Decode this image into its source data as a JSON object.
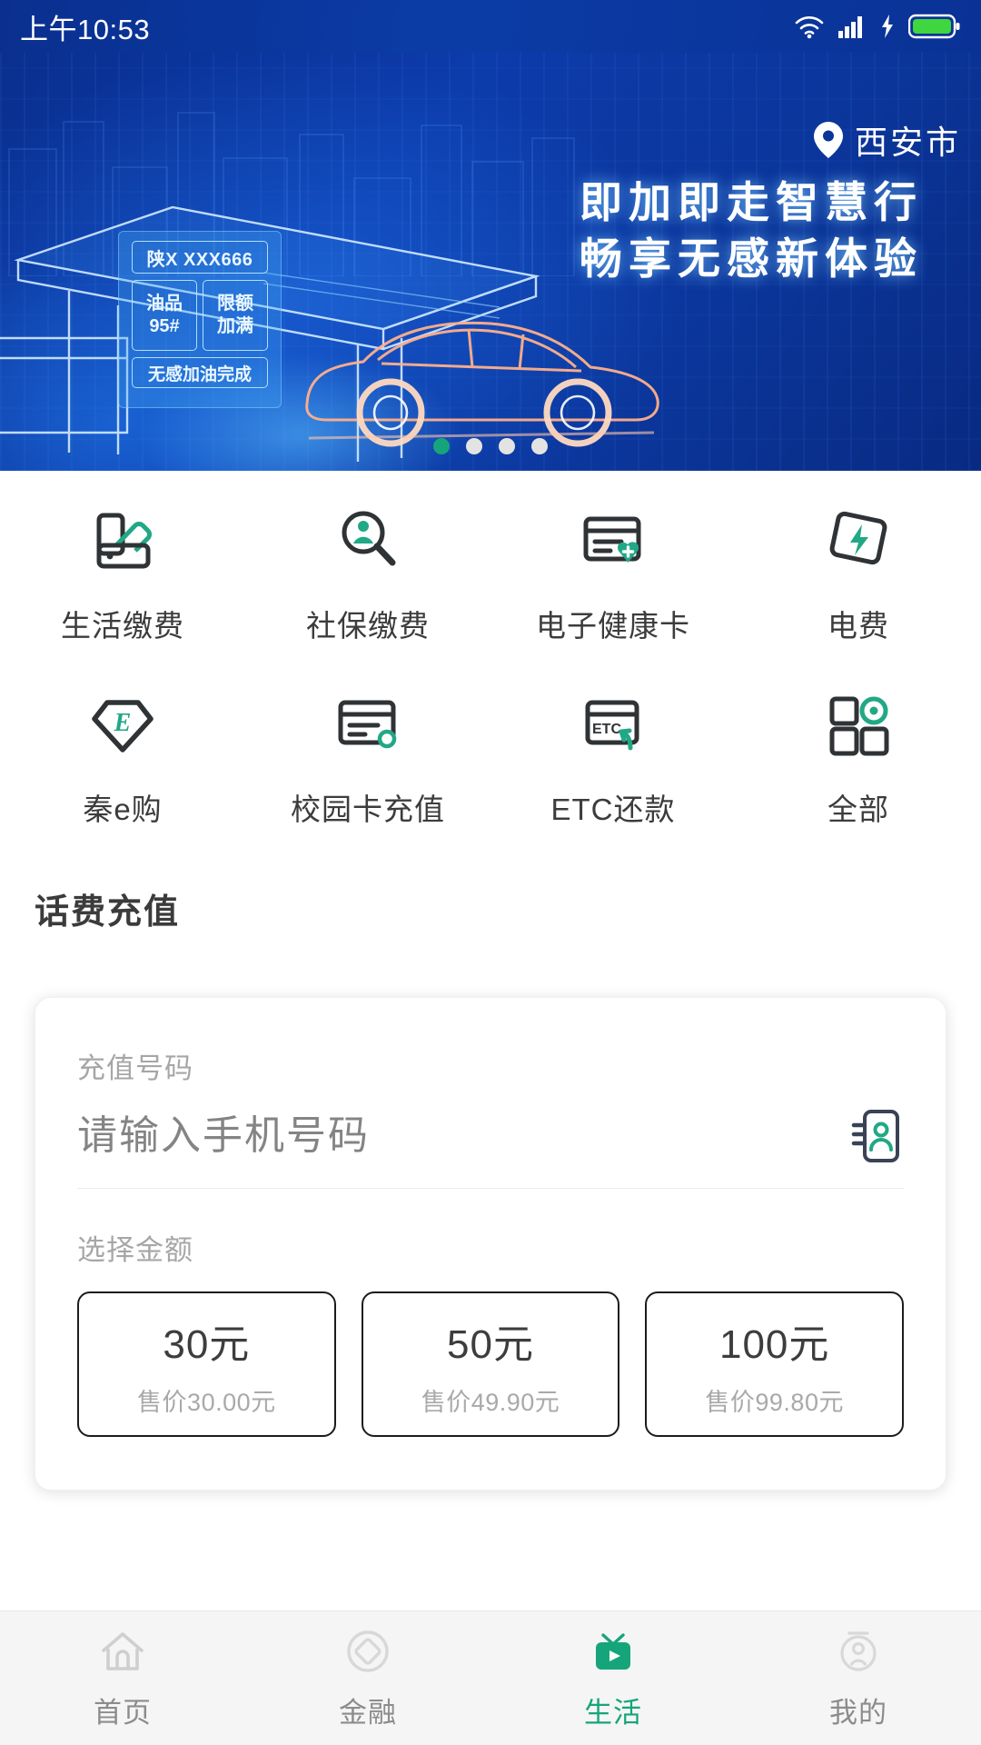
{
  "status_bar": {
    "time": "上午10:53",
    "icons": [
      "wifi-icon",
      "cellular-signal-icon",
      "charging-bolt-icon",
      "battery-icon"
    ]
  },
  "banner": {
    "location": "西安市",
    "location_icon": "location-pin-icon",
    "slogan_line1": "即加即走智慧行",
    "slogan_line2": "畅享无感新体验",
    "plate": "陕X XXX666",
    "fuel_label": "油品",
    "fuel_value": "95#",
    "limit_label": "限额",
    "limit_value": "加满",
    "status_text": "无感加油完成",
    "carousel": {
      "total": 4,
      "active_index": 0
    }
  },
  "services": [
    {
      "label": "生活缴费",
      "icon": "wallet-cards-icon"
    },
    {
      "label": "社保缴费",
      "icon": "magnifier-person-icon"
    },
    {
      "label": "电子健康卡",
      "icon": "card-health-heart-icon"
    },
    {
      "label": "电费",
      "icon": "card-lightning-icon"
    },
    {
      "label": "秦e购",
      "icon": "diamond-e-icon"
    },
    {
      "label": "校园卡充值",
      "icon": "card-circle-icon"
    },
    {
      "label": "ETC还款",
      "icon": "card-etc-arrow-icon"
    },
    {
      "label": "全部",
      "icon": "grid-four-squares-icon"
    }
  ],
  "recharge": {
    "section_title": "话费充值",
    "number_label": "充值号码",
    "number_placeholder": "请输入手机号码",
    "number_value": "",
    "contacts_icon": "contact-book-icon",
    "amount_label": "选择金额",
    "amounts": [
      {
        "value": "30元",
        "price": "售价30.00元"
      },
      {
        "value": "50元",
        "price": "售价49.90元"
      },
      {
        "value": "100元",
        "price": "售价99.80元"
      }
    ]
  },
  "tabbar": {
    "items": [
      {
        "label": "首页",
        "icon": "home-icon",
        "active": false
      },
      {
        "label": "金融",
        "icon": "coin-diamond-icon",
        "active": false
      },
      {
        "label": "生活",
        "icon": "tv-play-icon",
        "active": true
      },
      {
        "label": "我的",
        "icon": "profile-circle-icon",
        "active": false
      }
    ]
  },
  "colors": {
    "accent_green": "#16a57a",
    "banner_blue": "#0b3599",
    "icon_dark": "#2f3336",
    "muted_text": "#a6a6a6"
  }
}
